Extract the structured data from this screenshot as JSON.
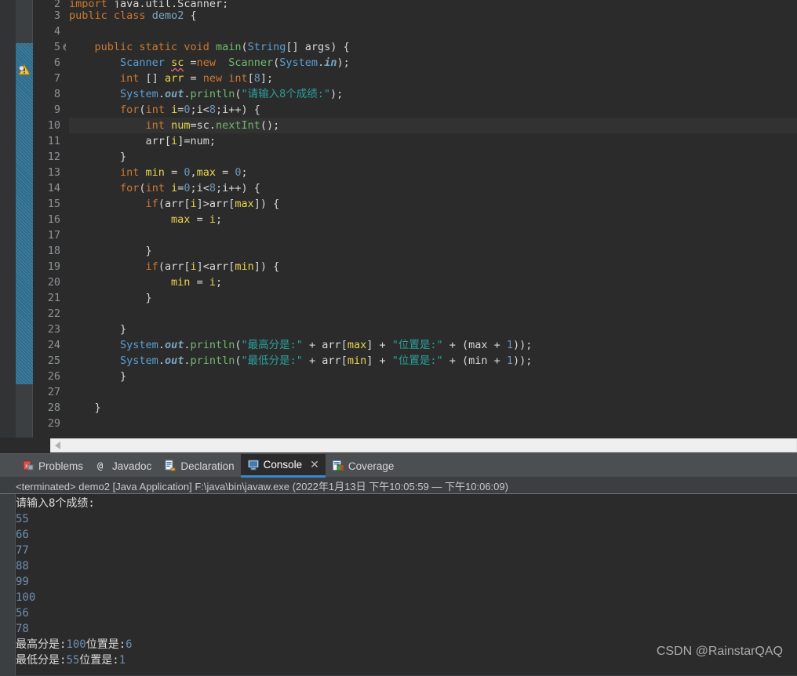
{
  "editor": {
    "current_line": 10,
    "warning_line": 6,
    "lines": [
      {
        "n": "2",
        "partial": true,
        "tokens": [
          {
            "t": "kw",
            "s": "import"
          },
          {
            "t": "pun",
            "s": " java.util.Scanner;"
          }
        ]
      },
      {
        "n": "3",
        "tokens": [
          {
            "t": "kw",
            "s": "public "
          },
          {
            "t": "kw",
            "s": "class "
          },
          {
            "t": "cls",
            "s": "demo2"
          },
          {
            "t": "pun",
            "s": " {"
          }
        ]
      },
      {
        "n": "4",
        "tokens": []
      },
      {
        "n": "5",
        "fold": true,
        "tokens": [
          {
            "t": "pun",
            "s": "    "
          },
          {
            "t": "kw",
            "s": "public "
          },
          {
            "t": "kw",
            "s": "static "
          },
          {
            "t": "kw",
            "s": "void "
          },
          {
            "t": "meth",
            "s": "main"
          },
          {
            "t": "pun",
            "s": "("
          },
          {
            "t": "type",
            "s": "String"
          },
          {
            "t": "pun",
            "s": "[] args) {"
          }
        ]
      },
      {
        "n": "6",
        "tokens": [
          {
            "t": "pun",
            "s": "        "
          },
          {
            "t": "type",
            "s": "Scanner "
          },
          {
            "t": "warn",
            "s": "sc"
          },
          {
            "t": "pun",
            "s": " ="
          },
          {
            "t": "kw",
            "s": "new"
          },
          {
            "t": "pun",
            "s": "  "
          },
          {
            "t": "meth",
            "s": "Scanner"
          },
          {
            "t": "pun",
            "s": "("
          },
          {
            "t": "type",
            "s": "System"
          },
          {
            "t": "pun",
            "s": "."
          },
          {
            "t": "stat",
            "s": "in"
          },
          {
            "t": "pun",
            "s": ");"
          }
        ]
      },
      {
        "n": "7",
        "tokens": [
          {
            "t": "pun",
            "s": "        "
          },
          {
            "t": "kw",
            "s": "int "
          },
          {
            "t": "pun",
            "s": "[] "
          },
          {
            "t": "var",
            "s": "arr"
          },
          {
            "t": "pun",
            "s": " = "
          },
          {
            "t": "kw",
            "s": "new "
          },
          {
            "t": "kw",
            "s": "int"
          },
          {
            "t": "pun",
            "s": "["
          },
          {
            "t": "num",
            "s": "8"
          },
          {
            "t": "pun",
            "s": "];"
          }
        ]
      },
      {
        "n": "8",
        "tokens": [
          {
            "t": "pun",
            "s": "        "
          },
          {
            "t": "type",
            "s": "System"
          },
          {
            "t": "pun",
            "s": "."
          },
          {
            "t": "stat",
            "s": "out"
          },
          {
            "t": "pun",
            "s": "."
          },
          {
            "t": "meth",
            "s": "println"
          },
          {
            "t": "pun",
            "s": "("
          },
          {
            "t": "str",
            "s": "\"请输入8个成绩:\""
          },
          {
            "t": "pun",
            "s": ");"
          }
        ]
      },
      {
        "n": "9",
        "tokens": [
          {
            "t": "pun",
            "s": "        "
          },
          {
            "t": "kw",
            "s": "for"
          },
          {
            "t": "pun",
            "s": "("
          },
          {
            "t": "kw",
            "s": "int "
          },
          {
            "t": "var",
            "s": "i"
          },
          {
            "t": "pun",
            "s": "="
          },
          {
            "t": "num",
            "s": "0"
          },
          {
            "t": "pun",
            "s": ";i<"
          },
          {
            "t": "num",
            "s": "8"
          },
          {
            "t": "pun",
            "s": ";i++) {"
          }
        ]
      },
      {
        "n": "10",
        "current": true,
        "tokens": [
          {
            "t": "pun",
            "s": "            "
          },
          {
            "t": "kw",
            "s": "int "
          },
          {
            "t": "var",
            "s": "num"
          },
          {
            "t": "pun",
            "s": "=sc."
          },
          {
            "t": "meth",
            "s": "nextInt"
          },
          {
            "t": "pun",
            "s": "();"
          }
        ]
      },
      {
        "n": "11",
        "tokens": [
          {
            "t": "pun",
            "s": "            arr["
          },
          {
            "t": "var",
            "s": "i"
          },
          {
            "t": "pun",
            "s": "]=num;"
          }
        ]
      },
      {
        "n": "12",
        "tokens": [
          {
            "t": "pun",
            "s": "        }"
          }
        ]
      },
      {
        "n": "13",
        "tokens": [
          {
            "t": "pun",
            "s": "        "
          },
          {
            "t": "kw",
            "s": "int "
          },
          {
            "t": "var",
            "s": "min"
          },
          {
            "t": "pun",
            "s": " = "
          },
          {
            "t": "num",
            "s": "0"
          },
          {
            "t": "pun",
            "s": ","
          },
          {
            "t": "var",
            "s": "max"
          },
          {
            "t": "pun",
            "s": " = "
          },
          {
            "t": "num",
            "s": "0"
          },
          {
            "t": "pun",
            "s": ";"
          }
        ]
      },
      {
        "n": "14",
        "tokens": [
          {
            "t": "pun",
            "s": "        "
          },
          {
            "t": "kw",
            "s": "for"
          },
          {
            "t": "pun",
            "s": "("
          },
          {
            "t": "kw",
            "s": "int "
          },
          {
            "t": "var",
            "s": "i"
          },
          {
            "t": "pun",
            "s": "="
          },
          {
            "t": "num",
            "s": "0"
          },
          {
            "t": "pun",
            "s": ";i<"
          },
          {
            "t": "num",
            "s": "8"
          },
          {
            "t": "pun",
            "s": ";i++) {"
          }
        ]
      },
      {
        "n": "15",
        "tokens": [
          {
            "t": "pun",
            "s": "            "
          },
          {
            "t": "kw",
            "s": "if"
          },
          {
            "t": "pun",
            "s": "(arr["
          },
          {
            "t": "var",
            "s": "i"
          },
          {
            "t": "pun",
            "s": "]>arr["
          },
          {
            "t": "var",
            "s": "max"
          },
          {
            "t": "pun",
            "s": "]) {"
          }
        ]
      },
      {
        "n": "16",
        "tokens": [
          {
            "t": "pun",
            "s": "                "
          },
          {
            "t": "var",
            "s": "max"
          },
          {
            "t": "pun",
            "s": " = "
          },
          {
            "t": "var",
            "s": "i"
          },
          {
            "t": "pun",
            "s": ";"
          }
        ]
      },
      {
        "n": "17",
        "tokens": []
      },
      {
        "n": "18",
        "tokens": [
          {
            "t": "pun",
            "s": "            }"
          }
        ]
      },
      {
        "n": "19",
        "tokens": [
          {
            "t": "pun",
            "s": "            "
          },
          {
            "t": "kw",
            "s": "if"
          },
          {
            "t": "pun",
            "s": "(arr["
          },
          {
            "t": "var",
            "s": "i"
          },
          {
            "t": "pun",
            "s": "]<arr["
          },
          {
            "t": "var",
            "s": "min"
          },
          {
            "t": "pun",
            "s": "]) {"
          }
        ]
      },
      {
        "n": "20",
        "tokens": [
          {
            "t": "pun",
            "s": "                "
          },
          {
            "t": "var",
            "s": "min"
          },
          {
            "t": "pun",
            "s": " = "
          },
          {
            "t": "var",
            "s": "i"
          },
          {
            "t": "pun",
            "s": ";"
          }
        ]
      },
      {
        "n": "21",
        "tokens": [
          {
            "t": "pun",
            "s": "            }"
          }
        ]
      },
      {
        "n": "22",
        "tokens": []
      },
      {
        "n": "23",
        "tokens": [
          {
            "t": "pun",
            "s": "        }"
          }
        ]
      },
      {
        "n": "24",
        "tokens": [
          {
            "t": "pun",
            "s": "        "
          },
          {
            "t": "type",
            "s": "System"
          },
          {
            "t": "pun",
            "s": "."
          },
          {
            "t": "stat",
            "s": "out"
          },
          {
            "t": "pun",
            "s": "."
          },
          {
            "t": "meth",
            "s": "println"
          },
          {
            "t": "pun",
            "s": "("
          },
          {
            "t": "str",
            "s": "\"最高分是:\""
          },
          {
            "t": "pun",
            "s": " + arr["
          },
          {
            "t": "var",
            "s": "max"
          },
          {
            "t": "pun",
            "s": "] + "
          },
          {
            "t": "str",
            "s": "\"位置是:\""
          },
          {
            "t": "pun",
            "s": " + (max + "
          },
          {
            "t": "num",
            "s": "1"
          },
          {
            "t": "pun",
            "s": "));"
          }
        ]
      },
      {
        "n": "25",
        "tokens": [
          {
            "t": "pun",
            "s": "        "
          },
          {
            "t": "type",
            "s": "System"
          },
          {
            "t": "pun",
            "s": "."
          },
          {
            "t": "stat",
            "s": "out"
          },
          {
            "t": "pun",
            "s": "."
          },
          {
            "t": "meth",
            "s": "println"
          },
          {
            "t": "pun",
            "s": "("
          },
          {
            "t": "str",
            "s": "\"最低分是:\""
          },
          {
            "t": "pun",
            "s": " + arr["
          },
          {
            "t": "var",
            "s": "min"
          },
          {
            "t": "pun",
            "s": "] + "
          },
          {
            "t": "str",
            "s": "\"位置是:\""
          },
          {
            "t": "pun",
            "s": " + (min + "
          },
          {
            "t": "num",
            "s": "1"
          },
          {
            "t": "pun",
            "s": "));"
          }
        ]
      },
      {
        "n": "26",
        "tokens": [
          {
            "t": "pun",
            "s": "        }"
          }
        ]
      },
      {
        "n": "27",
        "tokens": []
      },
      {
        "n": "28",
        "tokens": [
          {
            "t": "pun",
            "s": "    }"
          }
        ]
      },
      {
        "n": "29",
        "tokens": []
      }
    ]
  },
  "bottom_panel": {
    "tabs": [
      {
        "label": "Problems",
        "icon": "problems-icon",
        "active": false,
        "closable": false
      },
      {
        "label": "Javadoc",
        "icon": "javadoc-icon",
        "active": false,
        "closable": false
      },
      {
        "label": "Declaration",
        "icon": "declaration-icon",
        "active": false,
        "closable": false
      },
      {
        "label": "Console",
        "icon": "console-icon",
        "active": true,
        "closable": true,
        "close_label": "✕"
      },
      {
        "label": "Coverage",
        "icon": "coverage-icon",
        "active": false,
        "closable": false
      }
    ],
    "status_line": "<terminated> demo2 [Java Application] F:\\java\\bin\\javaw.exe  (2022年1月13日 下午10:05:59 — 下午10:06:09)",
    "console_lines": [
      {
        "text": "请输入8个成绩:",
        "kind": "stdout"
      },
      {
        "text": "55",
        "kind": "stdin"
      },
      {
        "text": "66",
        "kind": "stdin"
      },
      {
        "text": "77",
        "kind": "stdin"
      },
      {
        "text": "88",
        "kind": "stdin"
      },
      {
        "text": "99",
        "kind": "stdin"
      },
      {
        "text": "100",
        "kind": "stdin"
      },
      {
        "text": "56",
        "kind": "stdin"
      },
      {
        "text": "78",
        "kind": "stdin"
      },
      {
        "text": "最高分是:100位置是:6",
        "kind": "stdout-mixed",
        "parts": [
          {
            "c": "w",
            "s": "最高分是:"
          },
          {
            "c": "b",
            "s": "100"
          },
          {
            "c": "w",
            "s": "位置是:"
          },
          {
            "c": "b",
            "s": "6"
          }
        ]
      },
      {
        "text": "最低分是:55位置是:1",
        "kind": "stdout-mixed",
        "parts": [
          {
            "c": "w",
            "s": "最低分是:"
          },
          {
            "c": "b",
            "s": "55"
          },
          {
            "c": "w",
            "s": "位置是:"
          },
          {
            "c": "b",
            "s": "1"
          }
        ]
      }
    ]
  },
  "watermark": "CSDN @RainstarQAQ",
  "colors": {
    "editor_bg": "#2b2b2b",
    "gutter_text": "#8d9296",
    "current_line_bg": "#323232",
    "marker_highlight": "#2d6c8c",
    "panel_bg": "#3c3f41",
    "tabbar_bg": "#4b4f52",
    "active_tab_underline": "#3b87c9",
    "keyword": "#cc7832",
    "type": "#5a9fd4",
    "string": "#2aa198",
    "number": "#6897bb",
    "method": "#6fb86f",
    "variable": "#e8d44d",
    "stdin_text": "#6d8fb0"
  }
}
